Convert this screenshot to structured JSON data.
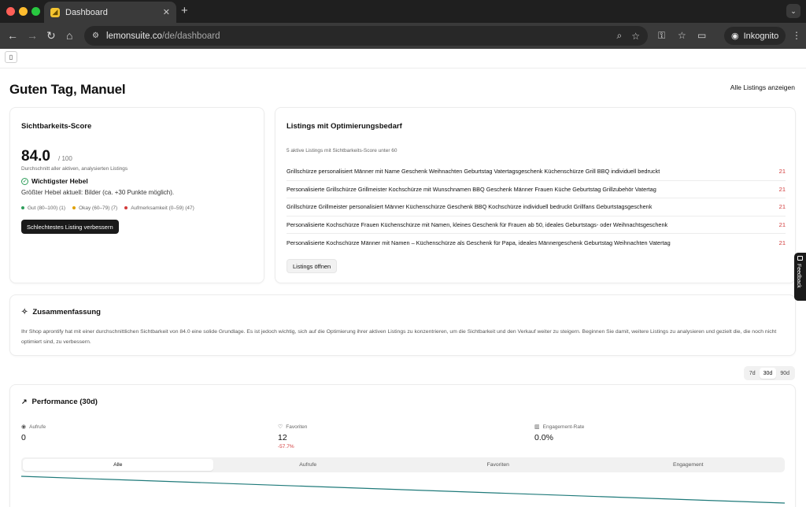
{
  "browser": {
    "tab_title": "Dashboard",
    "tab_close": "✕",
    "new_tab": "+",
    "url_host": "lemonsuite.co",
    "url_path": "/de/dashboard",
    "profile_label": "Inkognito"
  },
  "header": {
    "greeting": "Guten Tag, Manuel",
    "all_listings_link": "Alle Listings anzeigen"
  },
  "score_card": {
    "title": "Sichtbarkeits-Score",
    "score": "84.0",
    "max": "/ 100",
    "subtitle": "Durchschnitt aller aktiven, analysierten Listings",
    "lever_title": "Wichtigster Hebel",
    "lever_text": "Größter Hebel aktuell: Bilder (ca. +30 Punkte möglich).",
    "legend": [
      {
        "label": "Gut (80–100) (1)",
        "color": "#2e9e5b"
      },
      {
        "label": "Okay (60–79) (7)",
        "color": "#e0a100"
      },
      {
        "label": "Aufmerksamkeit (0–59) (47)",
        "color": "#d23b3b"
      }
    ],
    "button_label": "Schlechtestes Listing verbessern"
  },
  "listings_card": {
    "title": "Listings mit Optimierungsbedarf",
    "subtitle": "5 aktive Listings mit Sichtbarkeits-Score unter 60",
    "rows": [
      {
        "name": "Grillschürze personalisiert Männer mit Name Geschenk Weihnachten Geburtstag Vatertagsgeschenk Küchenschürze Grill BBQ individuell bedruckt",
        "score": "21"
      },
      {
        "name": "Personalisierte Grillschürze Grillmeister Kochschürze mit Wunschnamen BBQ Geschenk Männer Frauen Küche Geburtstag Grillzubehör Vatertag",
        "score": "21"
      },
      {
        "name": "Grillschürze Grillmeister personalisiert Männer Küchenschürze Geschenk BBQ Kochschürze individuell bedruckt Grillfans Geburtstagsgeschenk",
        "score": "21"
      },
      {
        "name": "Personalisierte Kochschürze Frauen Küchenschürze mit Namen, kleines Geschenk für Frauen ab 50, ideales Geburtstags- oder Weihnachtsgeschenk",
        "score": "21"
      },
      {
        "name": "Personalisierte Kochschürze Männer mit Namen – Küchenschürze als Geschenk für Papa, ideales Männergeschenk Geburtstag Weihnachten Vatertag",
        "score": "21"
      }
    ],
    "button_label": "Listings öffnen"
  },
  "summary": {
    "title": "Zusammenfassung",
    "text": "Ihr Shop aprontify hat mit einer durchschnittlichen Sichtbarkeit von 84.0 eine solide Grundlage. Es ist jedoch wichtig, sich auf die Optimierung ihrer aktiven Listings zu konzentrieren, um die Sichtbarkeit und den Verkauf weiter zu steigern. Beginnen Sie damit, weitere Listings zu analysieren und gezielt die, die noch nicht optimiert sind, zu verbessern."
  },
  "range": {
    "options": [
      "7d",
      "30d",
      "90d"
    ],
    "selected": "30d"
  },
  "performance": {
    "title": "Performance (30d)",
    "metrics": [
      {
        "label": "Aufrufe",
        "value": "0",
        "delta": ""
      },
      {
        "label": "Favoriten",
        "value": "12",
        "delta": "-57.7%"
      },
      {
        "label": "Engagement-Rate",
        "value": "0.0%",
        "delta": ""
      }
    ],
    "tabs": [
      "Alle",
      "Aufrufe",
      "Favoriten",
      "Engagement"
    ],
    "selected_tab": "Alle",
    "line_color": "#1f7a7a"
  },
  "feedback_label": "Feedback"
}
